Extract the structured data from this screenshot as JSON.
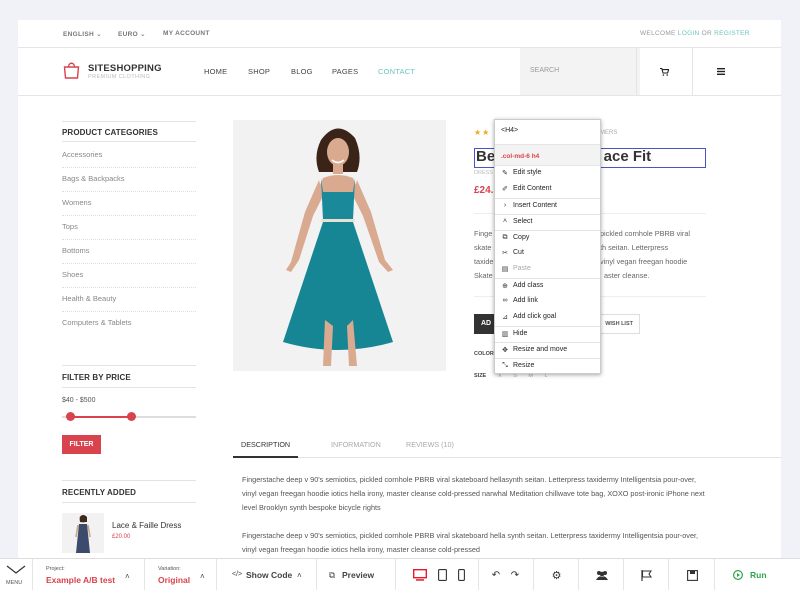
{
  "topbar": {
    "language": "ENGLISH",
    "currency": "EURO",
    "account": "MY ACCOUNT",
    "welcome": "WELCOME",
    "login": "LOGIN",
    "or": "OR",
    "register": "REGISTER"
  },
  "brand": {
    "name": "SITESHOPPING",
    "tagline": "PREMIUM CLOTHING"
  },
  "nav": {
    "items": [
      "HOME",
      "SHOP",
      "BLOG",
      "PAGES",
      "CONTACT"
    ],
    "active": "CONTACT",
    "search_placeholder": "SEARCH"
  },
  "sidebar": {
    "categories_title": "PRODUCT CATEGORIES",
    "categories": [
      "Accessories",
      "Bags & Backpacks",
      "Womens",
      "Tops",
      "Bottoms",
      "Shoes",
      "Health & Beauty",
      "Computers & Tablets"
    ],
    "price_title": "FILTER BY PRICE",
    "price_range": "$40 - $500",
    "price_selected": {
      "min_fraction": 0.03,
      "max_fraction": 0.49
    },
    "filter_label": "FILTER",
    "recent_title": "RECENTLY ADDED",
    "recent_item": {
      "name": "Lace & Faille Dress",
      "price": "£20.00"
    }
  },
  "product": {
    "title_left": "Be",
    "title_right": "ace Fit",
    "category": "DRESS",
    "reviews": "MERS",
    "price": "£24.",
    "rating_stars": 2,
    "desc_left": [
      "Finge",
      "skate",
      "taxide",
      "Skate"
    ],
    "desc_right": [
      "pickled cornhole PBRB viral",
      "th seitan. Letterpress",
      "vinyl vegan freegan hoodie",
      "aster cleanse."
    ],
    "add_label": "AD",
    "wish_label": "WISH LIST",
    "color_label": "COLOR",
    "size_label": "SIZE",
    "sizes": [
      "X",
      "S",
      "M",
      "L"
    ]
  },
  "tabs": [
    "DESCRIPTION",
    "INFORMATION",
    "REVIEWS (10)"
  ],
  "description": {
    "p1": "Fingerstache deep v 90's semiotics, pickled cornhole PBRB viral skateboard hellasynth seitan. Letterpress taxidermy Intelligentsia pour-over, vinyl vegan freegan hoodie iotics hella irony, master cleanse cold-pressed narwhal Meditation chillwave tote bag, XOXO post-ironic iPhone next level Brooklyn synth bespoke bicycle rights",
    "p2": "Fingerstache deep v 90's semiotics, pickled cornhole PBRB viral skateboard hella synth seitan. Letterpress taxidermy Intelligentsia pour-over, vinyl vegan freegan hoodie iotics hella irony, master cleanse cold-pressed"
  },
  "context_menu": {
    "header": "<H4>",
    "classes": ".col-md-6 h4",
    "items": [
      {
        "label": "Edit style",
        "icon": "pencil-icon"
      },
      {
        "label": "Edit Content",
        "icon": "edit-icon"
      },
      {
        "label": "Insert Content",
        "icon": "chevron-right-icon"
      },
      {
        "label": "Select",
        "icon": "chevron-up-icon"
      },
      {
        "label": "Copy",
        "icon": "copy-icon"
      },
      {
        "label": "Cut",
        "icon": "scissors-icon"
      },
      {
        "label": "Paste",
        "icon": "paste-icon"
      },
      {
        "label": "Add class",
        "icon": "plus-circle-icon"
      },
      {
        "label": "Add link",
        "icon": "link-icon"
      },
      {
        "label": "Add click goal",
        "icon": "click-icon"
      },
      {
        "label": "Hide",
        "icon": "trash-icon"
      },
      {
        "label": "Resize and move",
        "icon": "move-icon"
      },
      {
        "label": "Resize",
        "icon": "resize-icon"
      }
    ]
  },
  "toolbar": {
    "menu_label": "MENU",
    "project_label": "Project:",
    "project_value": "Example A/B test",
    "variation_label": "Variation:",
    "variation_value": "Original",
    "show_code": "Show Code",
    "preview": "Preview",
    "run": "Run",
    "colors": {
      "accent": "#d9434d",
      "run": "#2ea44f",
      "device_active": "#e8192c"
    }
  }
}
